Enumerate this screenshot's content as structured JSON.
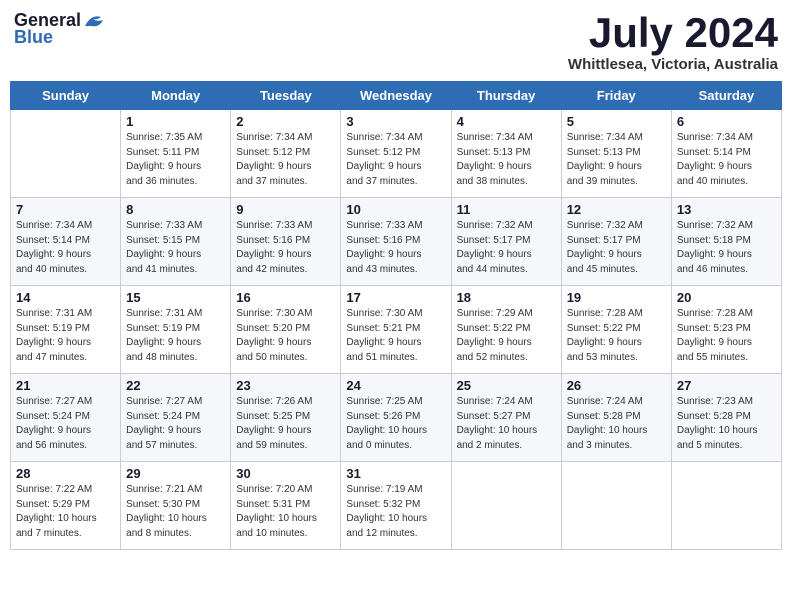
{
  "header": {
    "logo_line1": "General",
    "logo_line2": "Blue",
    "month_year": "July 2024",
    "location": "Whittlesea, Victoria, Australia"
  },
  "days_of_week": [
    "Sunday",
    "Monday",
    "Tuesday",
    "Wednesday",
    "Thursday",
    "Friday",
    "Saturday"
  ],
  "weeks": [
    [
      {
        "num": "",
        "info": ""
      },
      {
        "num": "1",
        "info": "Sunrise: 7:35 AM\nSunset: 5:11 PM\nDaylight: 9 hours\nand 36 minutes."
      },
      {
        "num": "2",
        "info": "Sunrise: 7:34 AM\nSunset: 5:12 PM\nDaylight: 9 hours\nand 37 minutes."
      },
      {
        "num": "3",
        "info": "Sunrise: 7:34 AM\nSunset: 5:12 PM\nDaylight: 9 hours\nand 37 minutes."
      },
      {
        "num": "4",
        "info": "Sunrise: 7:34 AM\nSunset: 5:13 PM\nDaylight: 9 hours\nand 38 minutes."
      },
      {
        "num": "5",
        "info": "Sunrise: 7:34 AM\nSunset: 5:13 PM\nDaylight: 9 hours\nand 39 minutes."
      },
      {
        "num": "6",
        "info": "Sunrise: 7:34 AM\nSunset: 5:14 PM\nDaylight: 9 hours\nand 40 minutes."
      }
    ],
    [
      {
        "num": "7",
        "info": "Sunrise: 7:34 AM\nSunset: 5:14 PM\nDaylight: 9 hours\nand 40 minutes."
      },
      {
        "num": "8",
        "info": "Sunrise: 7:33 AM\nSunset: 5:15 PM\nDaylight: 9 hours\nand 41 minutes."
      },
      {
        "num": "9",
        "info": "Sunrise: 7:33 AM\nSunset: 5:16 PM\nDaylight: 9 hours\nand 42 minutes."
      },
      {
        "num": "10",
        "info": "Sunrise: 7:33 AM\nSunset: 5:16 PM\nDaylight: 9 hours\nand 43 minutes."
      },
      {
        "num": "11",
        "info": "Sunrise: 7:32 AM\nSunset: 5:17 PM\nDaylight: 9 hours\nand 44 minutes."
      },
      {
        "num": "12",
        "info": "Sunrise: 7:32 AM\nSunset: 5:17 PM\nDaylight: 9 hours\nand 45 minutes."
      },
      {
        "num": "13",
        "info": "Sunrise: 7:32 AM\nSunset: 5:18 PM\nDaylight: 9 hours\nand 46 minutes."
      }
    ],
    [
      {
        "num": "14",
        "info": "Sunrise: 7:31 AM\nSunset: 5:19 PM\nDaylight: 9 hours\nand 47 minutes."
      },
      {
        "num": "15",
        "info": "Sunrise: 7:31 AM\nSunset: 5:19 PM\nDaylight: 9 hours\nand 48 minutes."
      },
      {
        "num": "16",
        "info": "Sunrise: 7:30 AM\nSunset: 5:20 PM\nDaylight: 9 hours\nand 50 minutes."
      },
      {
        "num": "17",
        "info": "Sunrise: 7:30 AM\nSunset: 5:21 PM\nDaylight: 9 hours\nand 51 minutes."
      },
      {
        "num": "18",
        "info": "Sunrise: 7:29 AM\nSunset: 5:22 PM\nDaylight: 9 hours\nand 52 minutes."
      },
      {
        "num": "19",
        "info": "Sunrise: 7:28 AM\nSunset: 5:22 PM\nDaylight: 9 hours\nand 53 minutes."
      },
      {
        "num": "20",
        "info": "Sunrise: 7:28 AM\nSunset: 5:23 PM\nDaylight: 9 hours\nand 55 minutes."
      }
    ],
    [
      {
        "num": "21",
        "info": "Sunrise: 7:27 AM\nSunset: 5:24 PM\nDaylight: 9 hours\nand 56 minutes."
      },
      {
        "num": "22",
        "info": "Sunrise: 7:27 AM\nSunset: 5:24 PM\nDaylight: 9 hours\nand 57 minutes."
      },
      {
        "num": "23",
        "info": "Sunrise: 7:26 AM\nSunset: 5:25 PM\nDaylight: 9 hours\nand 59 minutes."
      },
      {
        "num": "24",
        "info": "Sunrise: 7:25 AM\nSunset: 5:26 PM\nDaylight: 10 hours\nand 0 minutes."
      },
      {
        "num": "25",
        "info": "Sunrise: 7:24 AM\nSunset: 5:27 PM\nDaylight: 10 hours\nand 2 minutes."
      },
      {
        "num": "26",
        "info": "Sunrise: 7:24 AM\nSunset: 5:28 PM\nDaylight: 10 hours\nand 3 minutes."
      },
      {
        "num": "27",
        "info": "Sunrise: 7:23 AM\nSunset: 5:28 PM\nDaylight: 10 hours\nand 5 minutes."
      }
    ],
    [
      {
        "num": "28",
        "info": "Sunrise: 7:22 AM\nSunset: 5:29 PM\nDaylight: 10 hours\nand 7 minutes."
      },
      {
        "num": "29",
        "info": "Sunrise: 7:21 AM\nSunset: 5:30 PM\nDaylight: 10 hours\nand 8 minutes."
      },
      {
        "num": "30",
        "info": "Sunrise: 7:20 AM\nSunset: 5:31 PM\nDaylight: 10 hours\nand 10 minutes."
      },
      {
        "num": "31",
        "info": "Sunrise: 7:19 AM\nSunset: 5:32 PM\nDaylight: 10 hours\nand 12 minutes."
      },
      {
        "num": "",
        "info": ""
      },
      {
        "num": "",
        "info": ""
      },
      {
        "num": "",
        "info": ""
      }
    ]
  ]
}
